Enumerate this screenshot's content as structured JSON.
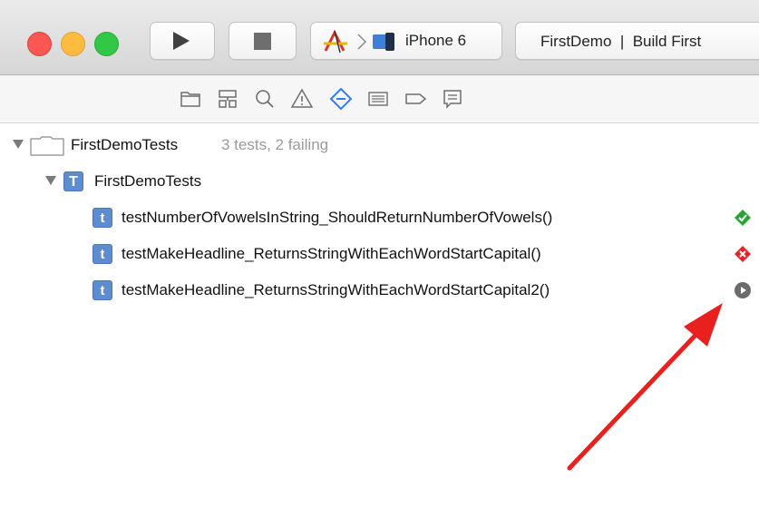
{
  "toolbar": {
    "scheme_device": "iPhone 6",
    "activity_text": "FirstDemo  |  Build First"
  },
  "navigator_icons": [
    "folder-icon",
    "hierarchy-icon",
    "search-icon",
    "warning-icon",
    "test-navigator-icon",
    "debug-icon",
    "breakpoint-icon",
    "report-icon"
  ],
  "tree": {
    "root": {
      "name": "FirstDemoTests",
      "summary": "3 tests, 2 failing"
    },
    "group": {
      "badge": "T",
      "name": "FirstDemoTests"
    },
    "tests": [
      {
        "badge": "t",
        "name": "testNumberOfVowelsInString_ShouldReturnNumberOfVowels()",
        "status": "passed"
      },
      {
        "badge": "t",
        "name": "testMakeHeadline_ReturnsStringWithEachWordStartCapital()",
        "status": "failed"
      },
      {
        "badge": "t",
        "name": "testMakeHeadline_ReturnsStringWithEachWordStartCapital2()",
        "status": "not-run"
      }
    ]
  },
  "colors": {
    "accent": "#2f7cf6",
    "passed": "#27a534",
    "failed": "#e0242a",
    "not_run": "#6b6b6b",
    "annotation_arrow": "#e8201e"
  }
}
